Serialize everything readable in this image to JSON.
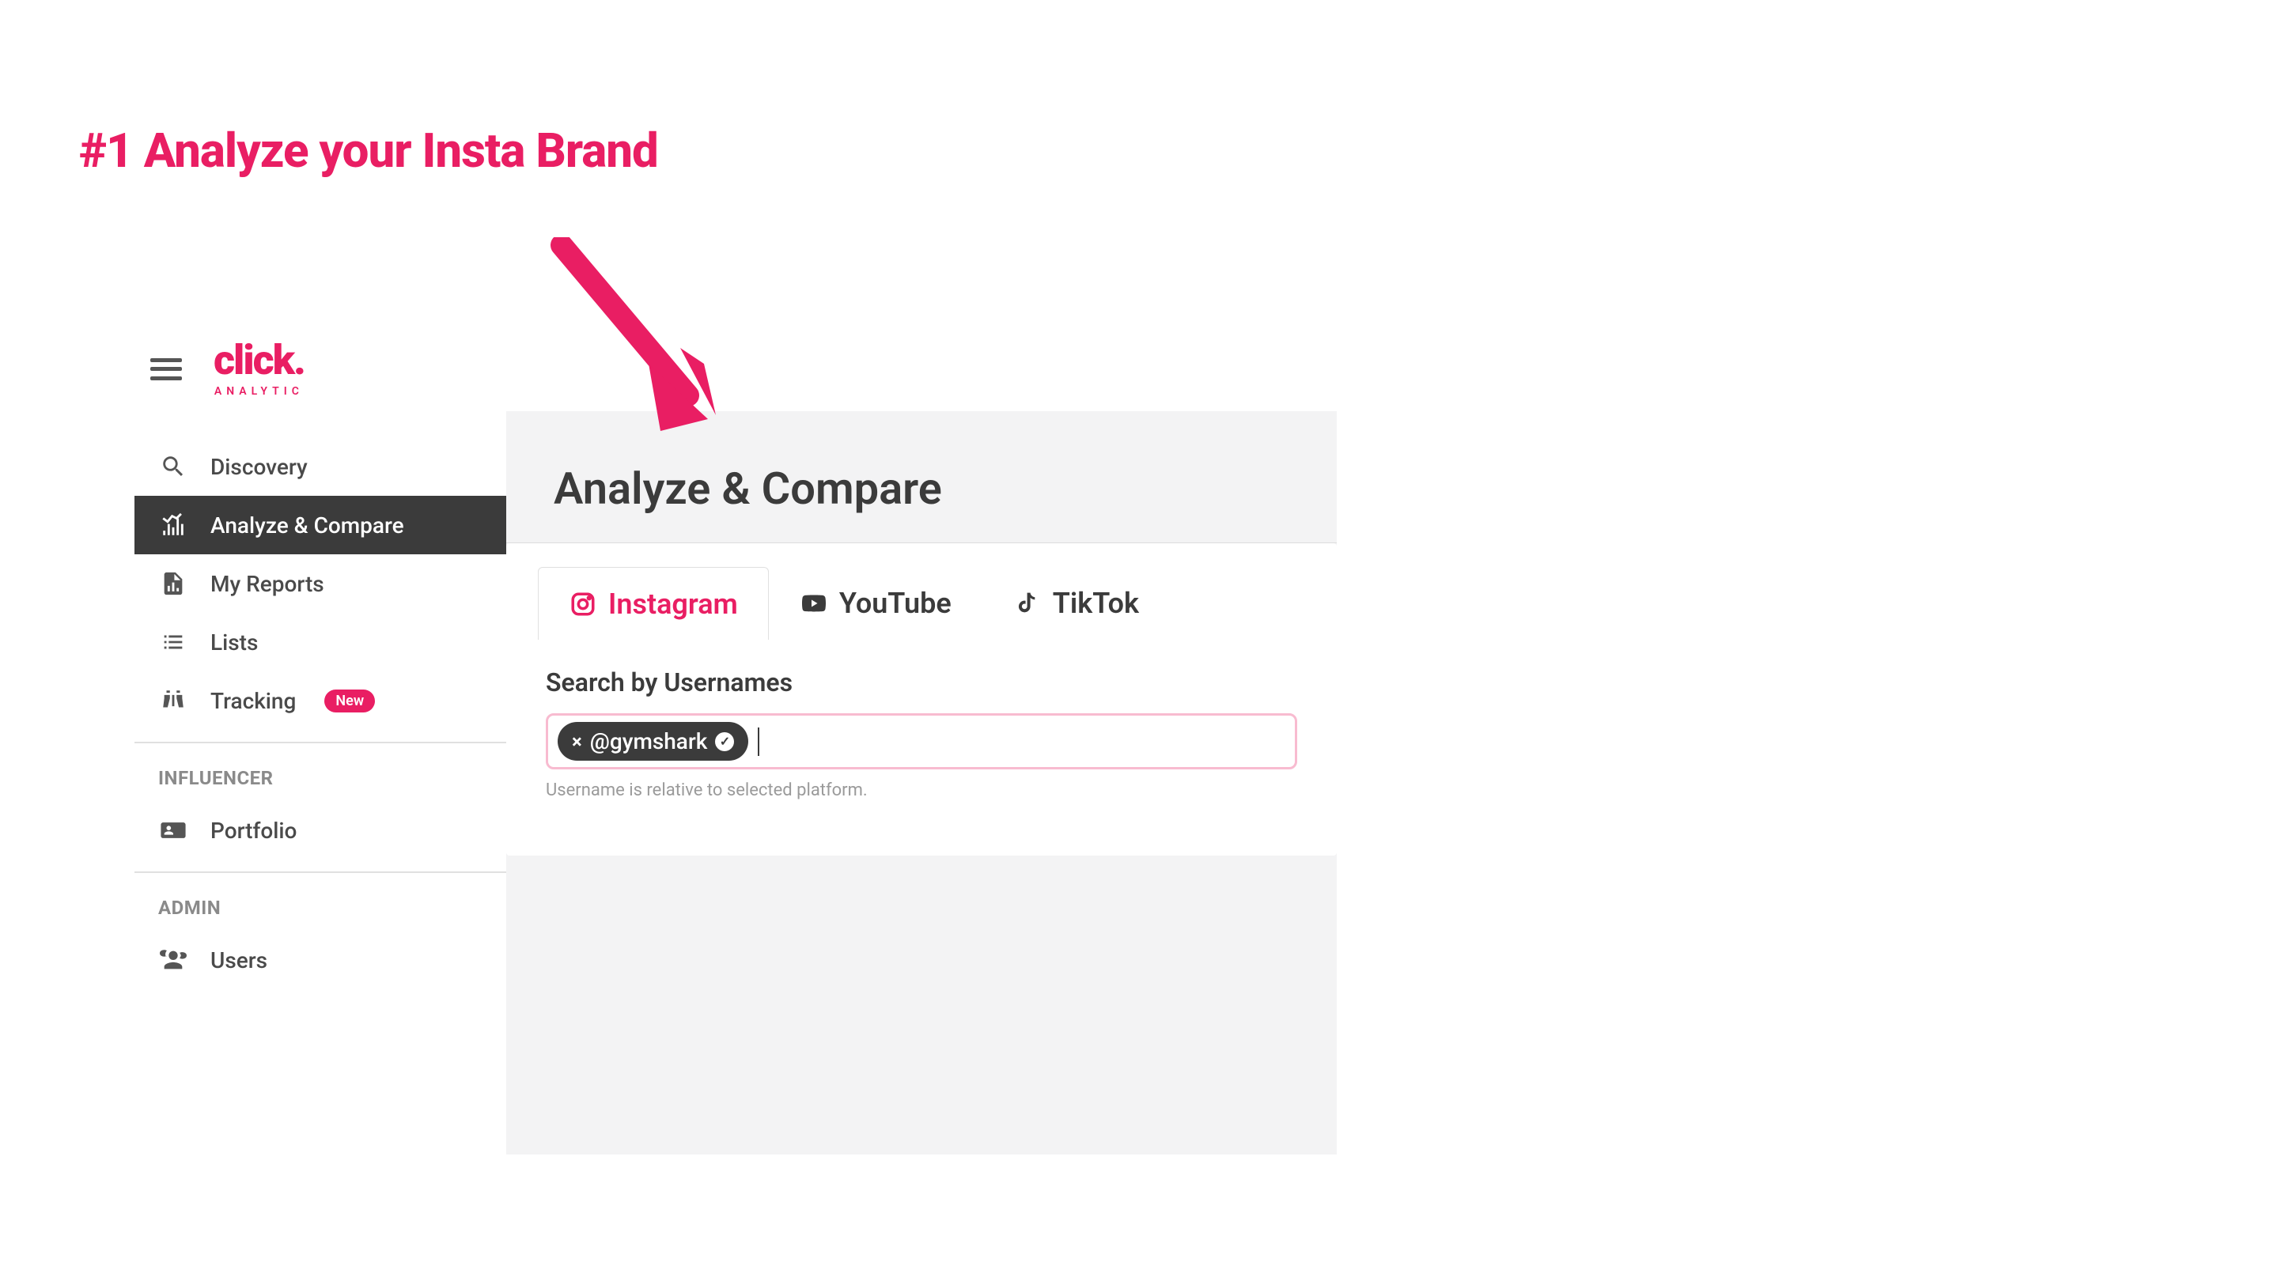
{
  "annotation": {
    "title": "#1 Analyze your Insta Brand"
  },
  "logo": {
    "text": "click.",
    "subtitle": "ANALYTIC"
  },
  "sidebar": {
    "nav": [
      {
        "label": "Discovery",
        "icon": "search"
      },
      {
        "label": "Analyze & Compare",
        "icon": "chart",
        "active": true
      },
      {
        "label": "My Reports",
        "icon": "report"
      },
      {
        "label": "Lists",
        "icon": "list"
      },
      {
        "label": "Tracking",
        "icon": "binoculars",
        "badge": "New"
      }
    ],
    "sections": [
      {
        "header": "INFLUENCER",
        "items": [
          {
            "label": "Portfolio",
            "icon": "id-card"
          }
        ]
      },
      {
        "header": "ADMIN",
        "items": [
          {
            "label": "Users",
            "icon": "users"
          }
        ]
      }
    ]
  },
  "main": {
    "title": "Analyze & Compare",
    "tabs": [
      {
        "label": "Instagram",
        "active": true
      },
      {
        "label": "YouTube"
      },
      {
        "label": "TikTok"
      }
    ],
    "search": {
      "label": "Search by Usernames",
      "chip": "@gymshark",
      "hint": "Username is relative to selected platform."
    }
  }
}
